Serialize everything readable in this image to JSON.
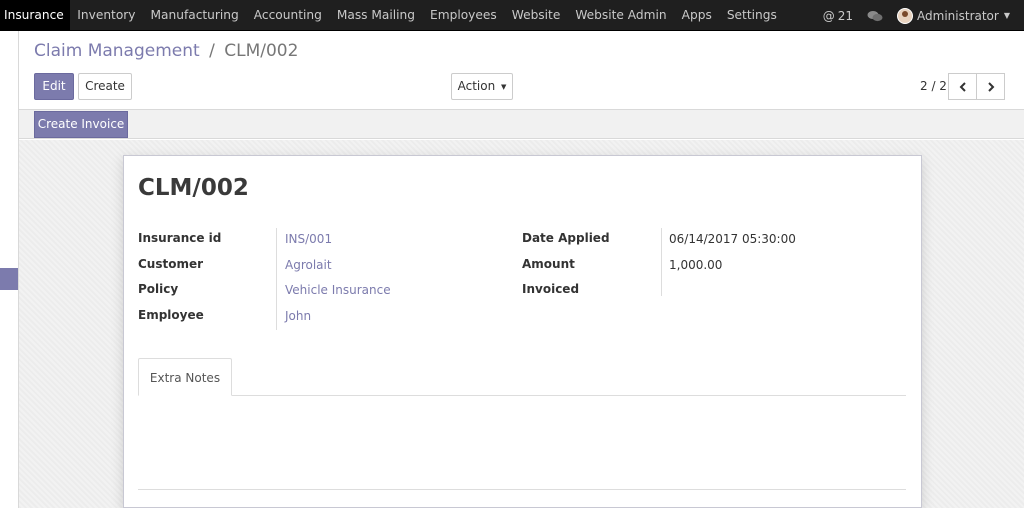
{
  "topbar": {
    "menu": [
      "Insurance",
      "Inventory",
      "Manufacturing",
      "Accounting",
      "Mass Mailing",
      "Employees",
      "Website",
      "Website Admin",
      "Apps",
      "Settings"
    ],
    "messages_count": "21",
    "user": "Administrator"
  },
  "breadcrumb": {
    "parent": "Claim Management",
    "separator": "/",
    "current": "CLM/002"
  },
  "buttons": {
    "edit": "Edit",
    "create": "Create",
    "action": "Action",
    "create_invoice": "Create Invoice"
  },
  "pager": {
    "text": "2 / 2"
  },
  "record": {
    "title": "CLM/002",
    "left_fields": [
      {
        "label": "Insurance id",
        "value": "INS/001"
      },
      {
        "label": "Customer",
        "value": "Agrolait"
      },
      {
        "label": "Policy",
        "value": "Vehicle Insurance"
      },
      {
        "label": "Employee",
        "value": "John"
      }
    ],
    "right_fields": [
      {
        "label": "Date Applied",
        "value": "06/14/2017 05:30:00"
      },
      {
        "label": "Amount",
        "value": "1,000.00"
      },
      {
        "label": "Invoiced",
        "value": ""
      }
    ]
  },
  "notebook": {
    "tab": "Extra Notes"
  },
  "colors": {
    "primary": "#7c7bad",
    "navbar": "#1f1f1f"
  },
  "icons": {
    "messages": "at-icon",
    "chat": "chat-bubbles-icon",
    "prev": "chevron-left-icon",
    "next": "chevron-right-icon",
    "caret": "caret-down-icon"
  }
}
